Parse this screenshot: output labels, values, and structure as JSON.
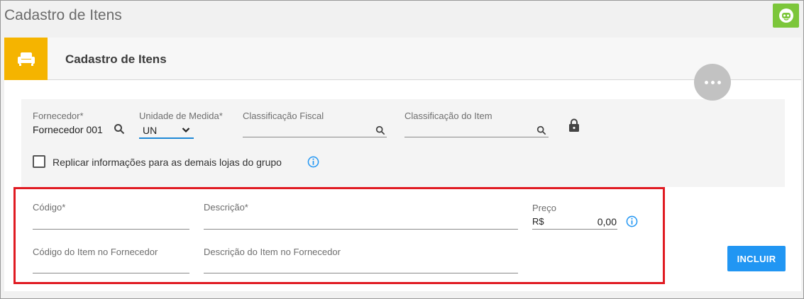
{
  "page": {
    "title": "Cadastro de Itens"
  },
  "colors": {
    "accent": "#f5b400",
    "chat": "#7cc63a",
    "primary": "#2196f3",
    "highlight": "#e01b22"
  },
  "card": {
    "title": "Cadastro de Itens",
    "header_icon": "sofa-icon"
  },
  "top": {
    "fornecedor": {
      "label": "Fornecedor*",
      "value": "Fornecedor 001"
    },
    "unidade": {
      "label": "Unidade de Medida*",
      "value": "UN"
    },
    "classificacao_fiscal": {
      "label": "Classificação Fiscal",
      "value": ""
    },
    "classificacao_item": {
      "label": "Classificação do Item",
      "value": ""
    },
    "replicar": {
      "label": "Replicar informações para as demais lojas do grupo",
      "checked": false
    }
  },
  "item": {
    "codigo": {
      "label": "Código*",
      "value": ""
    },
    "descricao": {
      "label": "Descrição*",
      "value": ""
    },
    "preco": {
      "label": "Preço",
      "currency": "R$",
      "value": "0,00"
    },
    "codigo_fornecedor": {
      "label": "Código do Item no Fornecedor",
      "value": ""
    },
    "descricao_fornecedor": {
      "label": "Descrição do Item no Fornecedor",
      "value": ""
    }
  },
  "actions": {
    "incluir": "INCLUIR"
  }
}
